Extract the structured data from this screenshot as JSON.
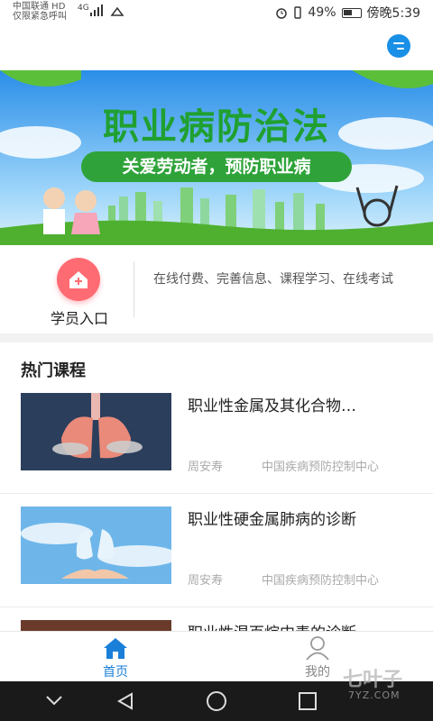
{
  "status_bar": {
    "carrier_line1": "中国联通 HD",
    "carrier_line2": "仅限紧急呼叫",
    "network": "4G",
    "battery": "49%",
    "time": "傍晚5:39"
  },
  "banner": {
    "title": "职业病防治法",
    "subtitle": "关爱劳动者，预防职业病"
  },
  "entry": {
    "label": "学员入口",
    "description": "在线付费、完善信息、课程学习、在线考试"
  },
  "hot_courses": {
    "title": "热门课程",
    "items": [
      {
        "title": "职业性金属及其化合物…",
        "author": "周安寿",
        "org": "中国疾病预防控制中心"
      },
      {
        "title": "职业性硬金属肺病的诊断",
        "author": "周安寿",
        "org": "中国疾病预防控制中心"
      },
      {
        "title": "职业性混百烷中毒的诊断"
      }
    ]
  },
  "tabs": [
    {
      "label": "首页",
      "icon": "home-icon",
      "active": true
    },
    {
      "label": "我的",
      "icon": "user-icon",
      "active": false
    }
  ],
  "watermark": {
    "text": "七叶子",
    "sub": "7YZ.COM"
  },
  "colors": {
    "accent": "#1a7fd8",
    "entry_icon": "#ff6b72",
    "banner_green": "#2fa33a"
  }
}
